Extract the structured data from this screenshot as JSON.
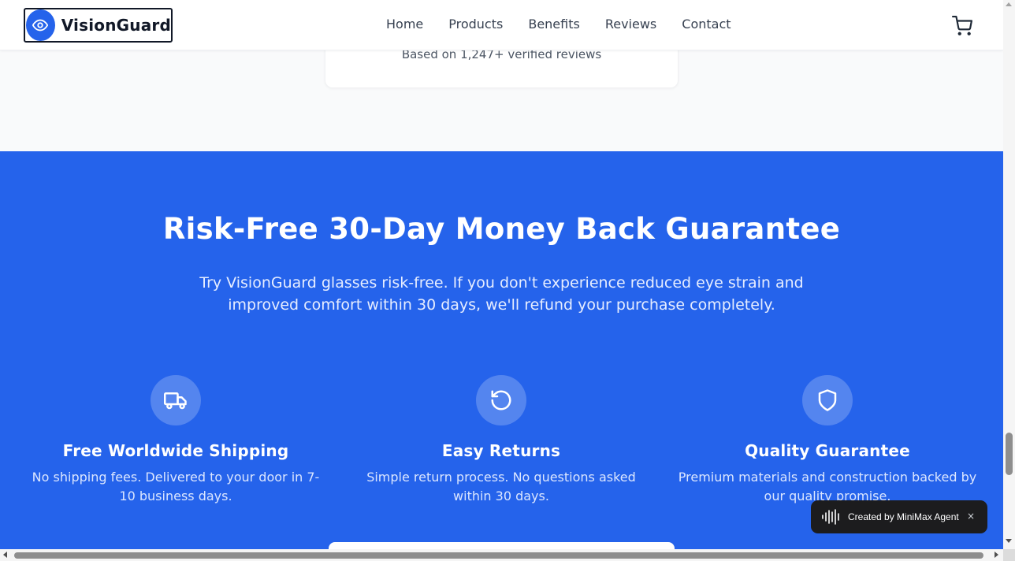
{
  "header": {
    "brand": "VisionGuard",
    "logo_icon": "eye-icon",
    "nav": [
      {
        "label": "Home"
      },
      {
        "label": "Products"
      },
      {
        "label": "Benefits"
      },
      {
        "label": "Reviews"
      },
      {
        "label": "Contact"
      }
    ],
    "cart_icon": "cart-icon"
  },
  "reviews": {
    "summary": "Based on 1,247+ verified reviews"
  },
  "guarantee": {
    "title": "Risk-Free 30-Day Money Back Guarantee",
    "description": "Try VisionGuard glasses risk-free. If you don't experience reduced eye strain and improved comfort within 30 days, we'll refund your purchase completely.",
    "features": [
      {
        "icon": "truck-icon",
        "title": "Free Worldwide Shipping",
        "description": "No shipping fees. Delivered to your door in 7-10 business days."
      },
      {
        "icon": "rotate-icon",
        "title": "Easy Returns",
        "description": "Simple return process. No questions asked within 30 days."
      },
      {
        "icon": "shield-icon",
        "title": "Quality Guarantee",
        "description": "Premium materials and construction backed by our quality promise."
      }
    ]
  },
  "badge": {
    "label": "Created by MiniMax Agent",
    "close": "×"
  },
  "colors": {
    "brand_blue": "#2563eb",
    "text_dark": "#111827",
    "badge_bg": "#1c1c1e"
  }
}
